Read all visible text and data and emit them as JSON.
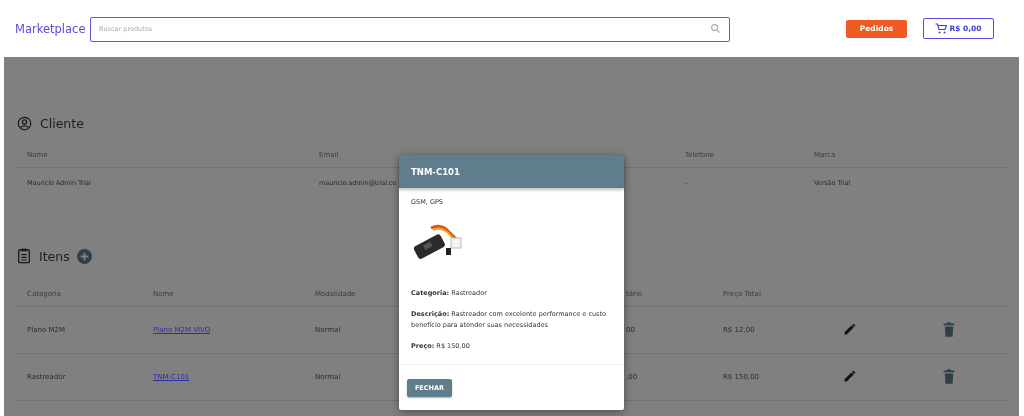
{
  "header": {
    "brand": "Marketplace",
    "search": {
      "placeholder": "Buscar produtos"
    },
    "orders_button": "Pedidos",
    "cart_button": "R$ 0,00"
  },
  "client": {
    "title": "Cliente",
    "columns": [
      "Nome",
      "Email",
      "Telefone",
      "Marca"
    ],
    "row": [
      "Mauricio Admin Trial",
      "mauricio.admin@trial.co",
      "-",
      "Versão Trial"
    ]
  },
  "items": {
    "title": "Itens",
    "columns": [
      "Categoria",
      "Nome",
      "Modalidade",
      "tário",
      "Preço Total"
    ],
    "rows": [
      {
        "category": "Plano M2M",
        "name": "Plano M2M VIVO",
        "mode": "Normal",
        "unit": "00",
        "total": "R$ 12,00"
      },
      {
        "category": "Rastreador",
        "name": "TNM-C101",
        "mode": "Normal",
        "unit": ",00",
        "total": "R$ 150,00"
      }
    ]
  },
  "modal": {
    "title": "TNM-C101",
    "subtitle": "GSM, GPS",
    "image": {
      "kind": "picture"
    },
    "fields": [
      "**Categoria:** Rastreador",
      "**Descrição:** Rastreador com excelente performance e custo benefício para atender suas necessidades",
      "**Preço:** R$ 150,00"
    ],
    "close_button": "FECHAR"
  }
}
